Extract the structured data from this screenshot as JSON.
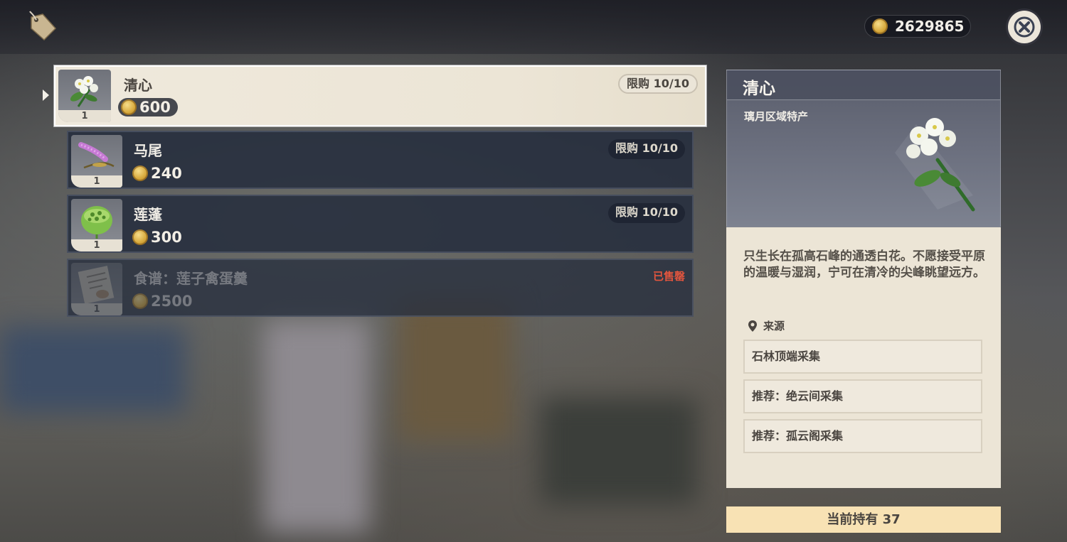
{
  "header": {
    "currency_value": "2629865"
  },
  "items": [
    {
      "name": "清心",
      "price": "600",
      "qty": "1",
      "limit": "限购 10/10",
      "selected": true
    },
    {
      "name": "马尾",
      "price": "240",
      "qty": "1",
      "limit": "限购 10/10"
    },
    {
      "name": "莲蓬",
      "price": "300",
      "qty": "1",
      "limit": "限购 10/10"
    },
    {
      "name": "食谱：莲子禽蛋羹",
      "price": "2500",
      "qty": "1",
      "status": "已售罄"
    }
  ],
  "detail": {
    "title": "清心",
    "subtitle": "璃月区域特产",
    "description": "只生长在孤高石峰的通透白花。不愿接受平原的温暖与湿润，宁可在清冷的尖峰眺望远方。",
    "source_label": "来源",
    "sources": [
      "石林顶端采集",
      "推荐：绝云间采集",
      "推荐：孤云阁采集"
    ],
    "holding": "当前持有 37"
  },
  "colors": {
    "accent_gold": "#d7a93c",
    "sold_out_red": "#e2553e",
    "panel_cream": "#ece5d6",
    "holding_bar": "#f8e2b4"
  }
}
